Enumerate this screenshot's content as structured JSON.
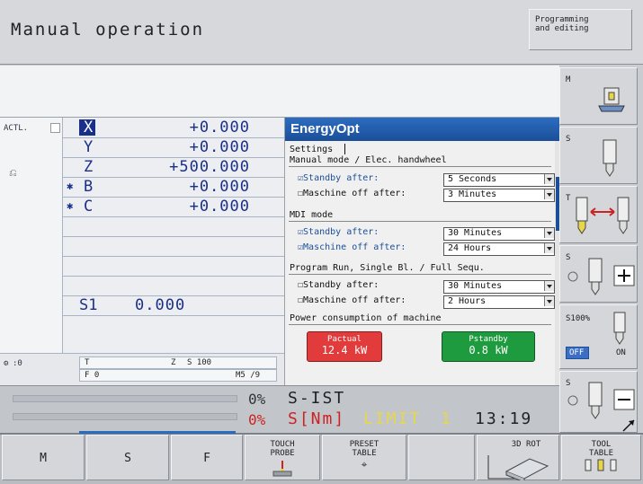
{
  "header": {
    "title": "Manual operation",
    "mode_line1": "Programming",
    "mode_line2": "and editing"
  },
  "position": {
    "actl_label": "ACTL.",
    "axes": [
      {
        "axis": "X",
        "value": "+0.000",
        "marker": ""
      },
      {
        "axis": "Y",
        "value": "+0.000",
        "marker": ""
      },
      {
        "axis": "Z",
        "value": "+500.000",
        "marker": ""
      },
      {
        "axis": "B",
        "value": "+0.000",
        "marker": "✱"
      },
      {
        "axis": "C",
        "value": "+0.000",
        "marker": "✱"
      }
    ],
    "spindle_label": "S1",
    "spindle_value": "0.000"
  },
  "status": {
    "tool_num": ":0",
    "t_label": "T",
    "z_label": "Z",
    "s_label": "S 100",
    "f_label": "F 0",
    "m_label": "M5 /9"
  },
  "energyopt": {
    "title": "EnergyOpt",
    "settings_label": "Settings",
    "sections": [
      {
        "heading": "Manual mode / Elec. handwheel",
        "rows": [
          {
            "checked": true,
            "label": "Standby after:",
            "value": "5  Seconds"
          },
          {
            "checked": false,
            "label": "Maschine off after:",
            "value": "3  Minutes"
          }
        ]
      },
      {
        "heading": "MDI mode",
        "rows": [
          {
            "checked": true,
            "label": "Standby after:",
            "value": "30 Minutes"
          },
          {
            "checked": true,
            "label": "Maschine off after:",
            "value": "24 Hours"
          }
        ]
      },
      {
        "heading": "Program Run, Single Bl. / Full Sequ.",
        "rows": [
          {
            "checked": false,
            "label": "Standby after:",
            "value": "30 Minutes"
          },
          {
            "checked": false,
            "label": "Maschine off after:",
            "value": "2  Hours"
          }
        ]
      }
    ],
    "power_heading": "Power consumption of machine",
    "p_actual_label": "Pactual",
    "p_actual_value": "12.4 kW",
    "p_standby_label": "Pstandby",
    "p_standby_value": "0.8 kW"
  },
  "bottom_status": {
    "sist_pct": "0%",
    "sist_label": "S-IST",
    "snm_pct": "0%",
    "snm_label": "S[Nm]",
    "limit_label": "LIMIT",
    "limit_num": "1",
    "clock": "13:19"
  },
  "vertical_softkeys": {
    "m_label": "M",
    "s_label": "S",
    "s100_label": "S100%",
    "off_label": "OFF",
    "on_label": "ON"
  },
  "softkeys": {
    "m": "M",
    "s": "S",
    "f": "F",
    "touch_probe_1": "TOUCH",
    "touch_probe_2": "PROBE",
    "preset_1": "PRESET",
    "preset_2": "TABLE",
    "rot": "3D ROT",
    "tool_1": "TOOL",
    "tool_2": "TABLE"
  },
  "colors": {
    "accent_blue": "#1b5aa8",
    "p_actual_bg": "#e23b3b",
    "p_standby_bg": "#1f9b3f",
    "limit_yellow": "#e7d64a",
    "red_text": "#cc2222"
  }
}
